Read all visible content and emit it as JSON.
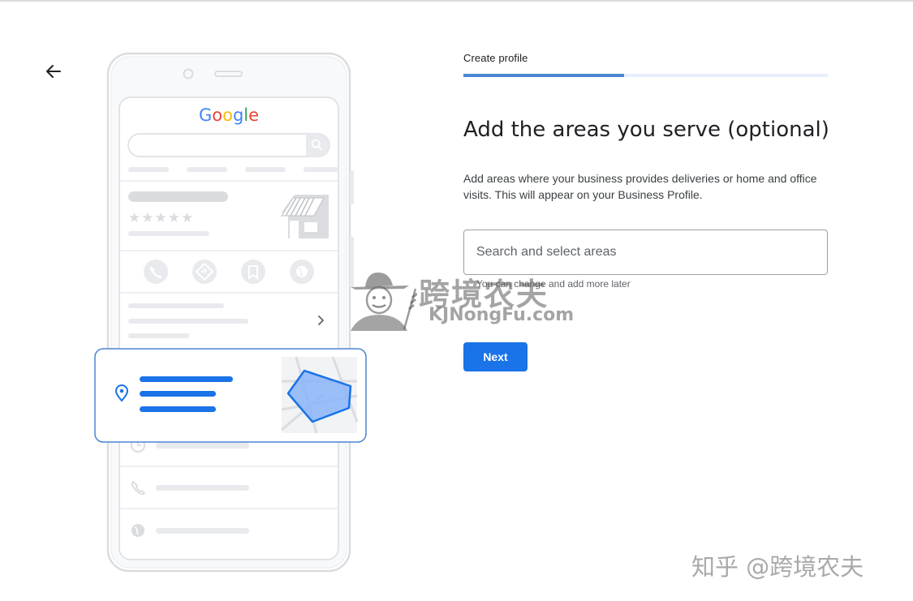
{
  "header": {
    "step_label": "Create profile",
    "progress": 0.44
  },
  "icons": {
    "back": "arrow-back-icon",
    "search": "search-icon",
    "phone": "phone-icon",
    "directions": "directions-icon",
    "bookmark": "bookmark-icon",
    "website": "globe-icon",
    "chevron": "chevron-right-icon",
    "location": "location-pin-icon",
    "clock": "clock-icon"
  },
  "illustration": {
    "logo_text": "Google",
    "rating_stars": "★★★★★"
  },
  "main": {
    "title": "Add the areas you serve (optional)",
    "description": "Add areas where your business provides deliveries or home and office visits. This will appear on your Business Profile.",
    "search": {
      "placeholder": "Search and select areas",
      "value": ""
    },
    "helper_text": "You can change and add more later",
    "next_label": "Next"
  },
  "watermark": {
    "center_cn": "跨境农夫",
    "center_en": "KJNongFu.com",
    "corner": "知乎 @跨境农夫"
  },
  "colors": {
    "accent": "#1a73e8",
    "progress": "#4a86d4",
    "progress_track": "#e8f0fe",
    "placeholder_gray": "#dadce0"
  }
}
